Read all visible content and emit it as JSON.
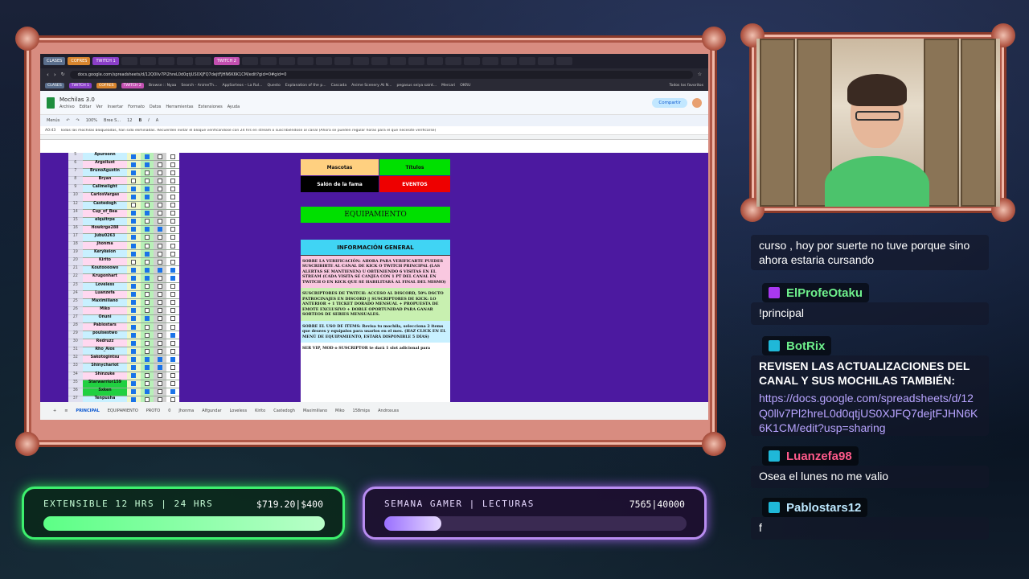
{
  "browser": {
    "tabs": [
      "CLASES",
      "COFRES",
      "TWITCH 1",
      "TWITCH 2"
    ],
    "url": "docs.google.com/spreadsheets/d/12Q0llv7Pl2hreL0d0qtjUS0XJFQ7dejtFJHN6K6K1CM/edit?gid=0#gid=0",
    "bookmarks": [
      "CLASES",
      "TWITCH 1",
      "COFRES",
      "TWITCH 2",
      "Browse :: Nyaa",
      "Search - AnimeTh...",
      "AppSorteos – La Rul...",
      "Questo",
      "Explanation of the p...",
      "Cascada",
      "Anime Scenery At N...",
      "pegasus seiya saint...",
      "Mercari",
      "OKRU",
      "Todos los favoritos"
    ]
  },
  "sheet": {
    "title": "Mochilas 3.0",
    "menus": [
      "Archivo",
      "Editar",
      "Ver",
      "Insertar",
      "Formato",
      "Datos",
      "Herramientas",
      "Extensiones",
      "Ayuda"
    ],
    "share_label": "Compartir",
    "toolbar": {
      "menus": "Menús",
      "zoom": "100%",
      "font": "Bree S...",
      "size": "12"
    },
    "cell_ref": "A0:43",
    "formula": "Todas las mochilas bloqueadas, han sido eliminadas. Recuerden evitar el bloque verificandose con 24 hrs en stream o suscribiéndose al canal (Ahora se pueden regular horas para el que necesite verificarse)",
    "rows": [
      {
        "n": "5",
        "name": "Apuroonn"
      },
      {
        "n": "6",
        "name": "Argollust"
      },
      {
        "n": "7",
        "name": "BrunoAgustin"
      },
      {
        "n": "8",
        "name": "Bryan"
      },
      {
        "n": "9",
        "name": "Callmelight"
      },
      {
        "n": "10",
        "name": "CarlosVargas"
      },
      {
        "n": "12",
        "name": "Castedogh"
      },
      {
        "n": "14",
        "name": "Cup_of_Bea"
      },
      {
        "n": "15",
        "name": "elquitrpe"
      },
      {
        "n": "16",
        "name": "Howkrge288"
      },
      {
        "n": "17",
        "name": "Jubu0263"
      },
      {
        "n": "18",
        "name": "Jhonma"
      },
      {
        "n": "19",
        "name": "Kerykeion"
      },
      {
        "n": "20",
        "name": "Kirito"
      },
      {
        "n": "21",
        "name": "Koutoooowo"
      },
      {
        "n": "22",
        "name": "Krugonhart"
      },
      {
        "n": "23",
        "name": "Loveless"
      },
      {
        "n": "24",
        "name": "Luanzefa"
      },
      {
        "n": "25",
        "name": "Maximiliano"
      },
      {
        "n": "26",
        "name": "Miko"
      },
      {
        "n": "27",
        "name": "Onuni"
      },
      {
        "n": "28",
        "name": "Pablostars"
      },
      {
        "n": "29",
        "name": "poulsestwo"
      },
      {
        "n": "30",
        "name": "Redruzz"
      },
      {
        "n": "31",
        "name": "Rho_Aios"
      },
      {
        "n": "32",
        "name": "Sakotogintsu"
      },
      {
        "n": "33",
        "name": "Shinychariot"
      },
      {
        "n": "34",
        "name": "Shinzuke"
      },
      {
        "n": "35",
        "name": "Starwarrior159"
      },
      {
        "n": "36",
        "name": "Sxken"
      },
      {
        "n": "37",
        "name": "Tenpusha"
      }
    ],
    "buttons": {
      "mascotas": "Mascotas",
      "titulos": "Títulos",
      "salon": "Salón de la fama",
      "eventos": "EVENTOS",
      "equipamiento": "EQUIPAMIENTO"
    },
    "info": {
      "title": "INFORMACIÓN GENERAL",
      "p1": "SOBRE LA VERIFICACIÓN: AHORA PARA VERIFICARTE PUEDES SUSCRIBIRTE AL CANAL DE KICK O TWITCH PRINCIPAL (LAS ALERTAS SE MANTIENEN) U OBTENIENDO 6 VISITAS EN EL STREAM (CADA VISITA SE CANJEA CON 1 PT DEL CANAL EN TWITCH O EN KICK QUE SE HABILITARÁ AL FINAL DEL MISMO)",
      "p2": "SUSCRIPTORES DE TWITCH: ACCESO AL DISCORD, 50% DSCTO PATROCINAJES EN DISCORD || SUSCRIPTORES DE KICK: LO ANTERIOR + 1 TICKET DORADO MENSUAL + PROPUESTA DE EMOTE EXCLUSIVO + DOBLE OPORTUNIDAD PARA GANAR SORTEOS DE SERIES MENSUALES.",
      "p3": "SOBRE EL USO DE ITEMS: Revisa tu mochila, selecciona 2 items que desees y equípalos para usarlos en el mes. (HAZ CLICK EN EL MENÚ DE EQUIPAMIENTO, ESTARÁ DISPONIBLE 5 DÍAS)",
      "p4": "SER VIP, MOD o SUSCRIPTOR te dará 1 slot adicional para"
    },
    "tabs": [
      "PRINCIPAL",
      "EQUIPAMIENTO",
      "PROTO",
      "0",
      "Jhonma",
      "Alfgundar",
      "Loveless",
      "Kirito",
      "Castedogh",
      "Maximiliano",
      "Miko",
      "158mips",
      "Androxuss"
    ]
  },
  "chat": {
    "m0": "curso , hoy por suerte no tuve porque sino ahora estaria cursando",
    "u1": "ElProfeOtaku",
    "m1": "!principal",
    "u2": "BotRix",
    "m2": "REVISEN LAS ACTUALIZACIONES DEL CANAL Y SUS MOCHILAS TAMBIÉN:",
    "m2link": "https://docs.google.com/spreadsheets/d/12Q0llv7Pl2hreL0d0qtjUS0XJFQ7dejtFJHN6K6K1CM/edit?usp=sharing",
    "u3": "Luanzefa98",
    "m3": "Osea el lunes no me valio",
    "u4": "Pablostars12",
    "m4": "f"
  },
  "goals": {
    "g1": {
      "label": "EXTENSIBLE 12 HRS | 24 HRS",
      "value": "$719.20|$400",
      "progress": 1.0
    },
    "g2": {
      "label": "SEMANA GAMER | LECTURAS",
      "value": "7565|40000",
      "progress": 0.19
    }
  },
  "colors": {
    "accent_green": "#3df06e",
    "accent_purple": "#b88cf0",
    "sheet_bg": "#4c19a0",
    "info_title": "#40d4f4"
  }
}
